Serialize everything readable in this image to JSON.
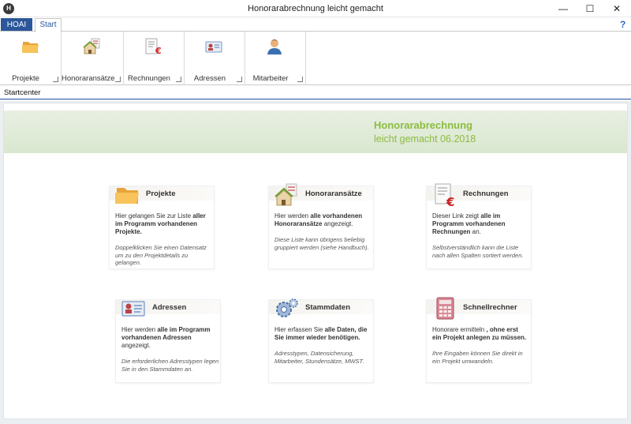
{
  "window": {
    "app_icon_letter": "H",
    "title": "Honorarabrechnung leicht gemacht",
    "minimize_glyph": "—",
    "maximize_glyph": "☐",
    "close_glyph": "✕"
  },
  "tabs": {
    "file_label": "HOAI",
    "start_label": "Start",
    "help_glyph": "?"
  },
  "ribbon": {
    "groups": [
      {
        "label": "Projekte",
        "icon": "folder-icon"
      },
      {
        "label": "Honoraransätze",
        "icon": "house-document-icon"
      },
      {
        "label": "Rechnungen",
        "icon": "invoice-euro-icon"
      },
      {
        "label": "Adressen",
        "icon": "address-card-icon"
      },
      {
        "label": "Mitarbeiter",
        "icon": "person-icon"
      }
    ]
  },
  "panel": {
    "title": "Startcenter"
  },
  "banner": {
    "line1": "Honorarabrechnung",
    "line2": "leicht gemacht 06.2018"
  },
  "cards": {
    "projekte": {
      "title": "Projekte",
      "desc_pre": "Hier gelangen Sie zur Liste ",
      "desc_bold": "aller im Programm vorhandenen Projekte.",
      "note": "Doppelklicken Sie einen Datensatz um zu den Projektdetails zu gelangen."
    },
    "honoraransaetze": {
      "title": "Honoraransätze",
      "desc_pre": "Hier werden ",
      "desc_bold": "alle vorhandenen Honoraransätze",
      "desc_post": " angezeigt.",
      "note": "Diese Liste kann übrigens beliebig gruppiert werden (siehe Handbuch)."
    },
    "rechnungen": {
      "title": "Rechnungen",
      "desc_pre": "Dieser Link zeigt ",
      "desc_bold": "alle im Programm vorhandenen Rechnungen",
      "desc_post": " an.",
      "note": "Selbstverständlich kann die Liste nach allen Spalten sortiert werden."
    },
    "adressen": {
      "title": "Adressen",
      "desc_pre": "Hier werden ",
      "desc_bold": "alle im Programm vorhandenen Adressen",
      "desc_post": " angezeigt.",
      "note": "Die erforderlichen Adresstypen legen Sie in den Stammdaten an."
    },
    "stammdaten": {
      "title": "Stammdaten",
      "desc_pre": "Hier erfassen Sie ",
      "desc_bold": "alle Daten, die Sie immer wieder benötigen.",
      "note": "Adresstypen, Datensicherung, Mitarbeiter, Stundensätze, MWST."
    },
    "schnellrechner": {
      "title": "Schnellrechner",
      "desc_pre": "Honorare ermitteln",
      "desc_bold": " , ohne erst ein Projekt anlegen zu müssen.",
      "note": "Ihre Eingaben können Sie direkt in ein Projekt umwandeln."
    }
  },
  "colors": {
    "accent_blue": "#2b579a",
    "banner_green": "#8cbc3f"
  }
}
